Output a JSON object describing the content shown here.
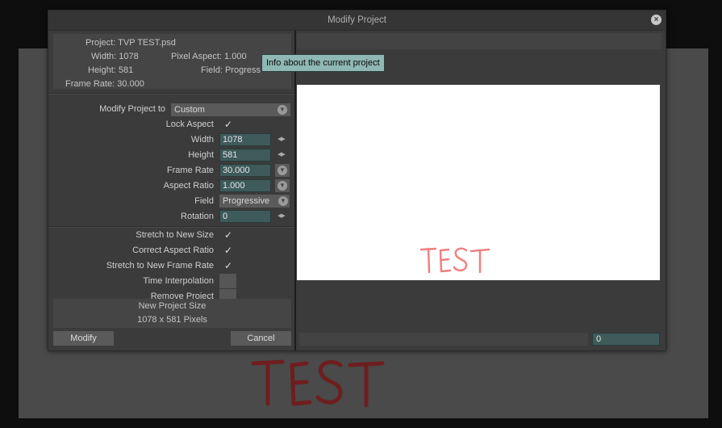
{
  "window": {
    "title": "Modify Project",
    "close_glyph": "×"
  },
  "project_info": {
    "project": "Project: TVP TEST.psd",
    "width": "Width: 1078",
    "pixel_aspect": "Pixel Aspect: 1.000",
    "height": "Height: 581",
    "field": "Field: Progress",
    "frame_rate": "Frame Rate: 30.000"
  },
  "tooltip": "Info about the current project",
  "form": {
    "modify_to_label": "Modify Project to",
    "modify_to_value": "Custom",
    "lock_aspect_label": "Lock Aspect",
    "width_label": "Width",
    "width_value": "1078",
    "height_label": "Height",
    "height_value": "581",
    "frame_rate_label": "Frame Rate",
    "frame_rate_value": "30.000",
    "aspect_ratio_label": "Aspect Ratio",
    "aspect_ratio_value": "1.000",
    "field_label": "Field",
    "field_value": "Progressive",
    "rotation_label": "Rotation",
    "rotation_value": "0"
  },
  "options": {
    "stretch_size": "Stretch to New Size",
    "correct_aspect": "Correct Aspect Ratio",
    "stretch_frame_rate": "Stretch to New Frame Rate",
    "time_interpolation": "Time Interpolation",
    "remove_project": "Remove Project",
    "check_glyph": "✓"
  },
  "new_size": {
    "title": "New Project Size",
    "value": "1078 x 581 Pixels"
  },
  "buttons": {
    "modify": "Modify",
    "cancel": "Cancel"
  },
  "preview": {
    "frame_value": "0"
  },
  "icons": {
    "dropdown": "chevron-down-icon",
    "spin": "spin-arrows-icon",
    "close": "close-icon"
  },
  "colors": {
    "field_bg": "#3e5a5a",
    "tooltip_bg": "#8fb7b3",
    "scribble_preview": "#f08080",
    "scribble_bg": "#7a2020"
  }
}
